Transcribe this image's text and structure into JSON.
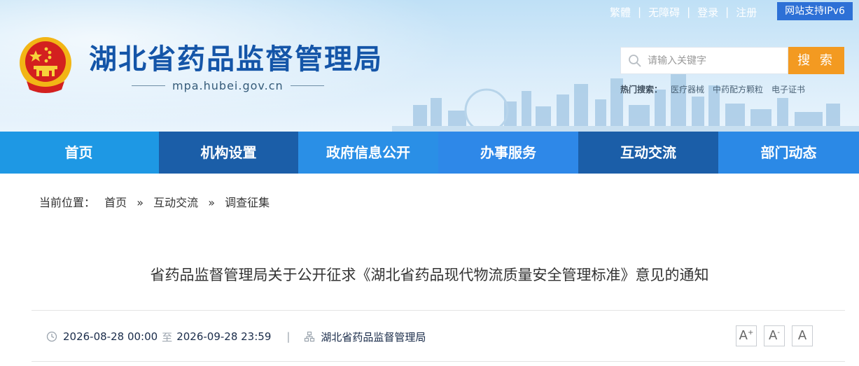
{
  "site": {
    "title": "湖北省药品监督管理局",
    "domain": "mpa.hubei.gov.cn"
  },
  "toplinks": [
    "繁體",
    "无障碍",
    "登录",
    "注册"
  ],
  "ipv6_badge": "网站支持IPv6",
  "search": {
    "placeholder": "请输入关键字",
    "button": "搜 索",
    "hot_label": "热门搜索：",
    "hot_terms": [
      "医疗器械",
      "中药配方颗粒",
      "电子证书"
    ]
  },
  "nav": [
    "首页",
    "机构设置",
    "政府信息公开",
    "办事服务",
    "互动交流",
    "部门动态"
  ],
  "breadcrumb": {
    "label": "当前位置：",
    "items": [
      "首页",
      "互动交流",
      "调查征集"
    ],
    "separator": "»"
  },
  "article": {
    "title": "省药品监督管理局关于公开征求《湖北省药品现代物流质量安全管理标准》意见的通知",
    "start": "2026-08-28 00:00",
    "to": "至",
    "end": "2026-09-28 23:59",
    "publisher": "湖北省药品监督管理局"
  },
  "font_buttons": [
    "A",
    "A",
    "A"
  ],
  "colors": {
    "brand_blue": "#1455a8",
    "nav_light": "#1e98e4",
    "nav_dark": "#1b5ea8",
    "search_button": "#f39a21",
    "ipv6_badge": "#2d70d6"
  }
}
